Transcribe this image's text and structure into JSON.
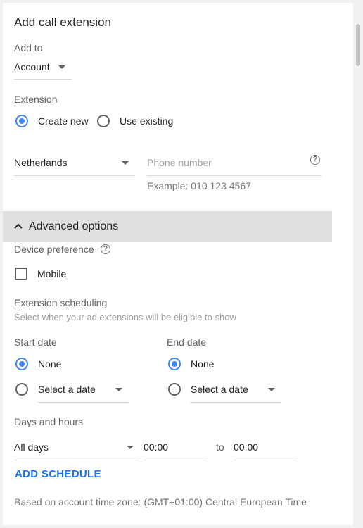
{
  "dialog": {
    "title": "Add call extension"
  },
  "add_to": {
    "label": "Add to",
    "value": "Account"
  },
  "extension": {
    "label": "Extension",
    "options": [
      {
        "label": "Create new",
        "selected": true
      },
      {
        "label": "Use existing",
        "selected": false
      }
    ]
  },
  "phone": {
    "country": "Netherlands",
    "placeholder": "Phone number",
    "example": "Example: 010 123 4567"
  },
  "advanced": {
    "label": "Advanced options",
    "expanded": true
  },
  "device": {
    "label": "Device preference",
    "mobile_label": "Mobile",
    "mobile_checked": false
  },
  "scheduling": {
    "label": "Extension scheduling",
    "hint": "Select when your ad extensions will be eligible to show"
  },
  "start_date": {
    "label": "Start date",
    "none_label": "None",
    "select_label": "Select a date"
  },
  "end_date": {
    "label": "End date",
    "none_label": "None",
    "select_label": "Select a date"
  },
  "days_hours": {
    "label": "Days and hours",
    "days_value": "All days",
    "from": "00:00",
    "to_label": "to",
    "to": "00:00"
  },
  "add_schedule_label": "ADD SCHEDULE",
  "timezone_note": "Based on account time zone: (GMT+01:00) Central European Time",
  "colors": {
    "accent": "#4285f4",
    "link": "#1a73e8",
    "panel_bg": "#ffffff",
    "page_bg": "#f1f1f1"
  },
  "icons": {
    "caret": "chevron-down-icon",
    "help": "help-circle-icon",
    "collapse": "chevron-up-icon"
  }
}
